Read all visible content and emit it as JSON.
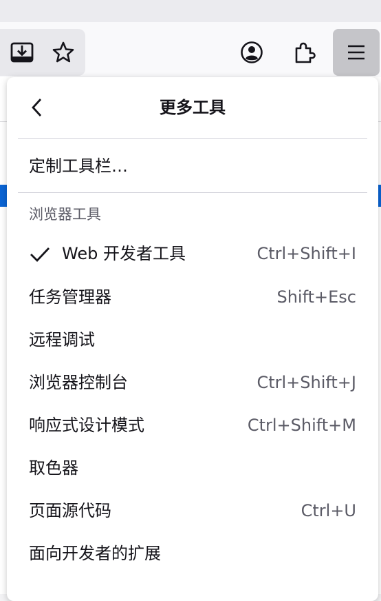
{
  "panel": {
    "title": "更多工具",
    "customize_label": "定制工具栏…",
    "section_title": "浏览器工具",
    "items": [
      {
        "label": "Web 开发者工具",
        "shortcut": "Ctrl+Shift+I",
        "checked": true
      },
      {
        "label": "任务管理器",
        "shortcut": "Shift+Esc"
      },
      {
        "label": "远程调试",
        "shortcut": ""
      },
      {
        "label": "浏览器控制台",
        "shortcut": "Ctrl+Shift+J"
      },
      {
        "label": "响应式设计模式",
        "shortcut": "Ctrl+Shift+M"
      },
      {
        "label": "取色器",
        "shortcut": ""
      },
      {
        "label": "页面源代码",
        "shortcut": "Ctrl+U"
      },
      {
        "label": "面向开发者的扩展",
        "shortcut": ""
      }
    ]
  },
  "toolbar": {
    "icons": [
      "downloads-icon",
      "bookmark-star-icon",
      "account-icon",
      "extensions-icon",
      "hamburger-menu-icon"
    ]
  },
  "colors": {
    "selection": "#0a64d4",
    "menu_button_active": "#c5c5c9"
  }
}
